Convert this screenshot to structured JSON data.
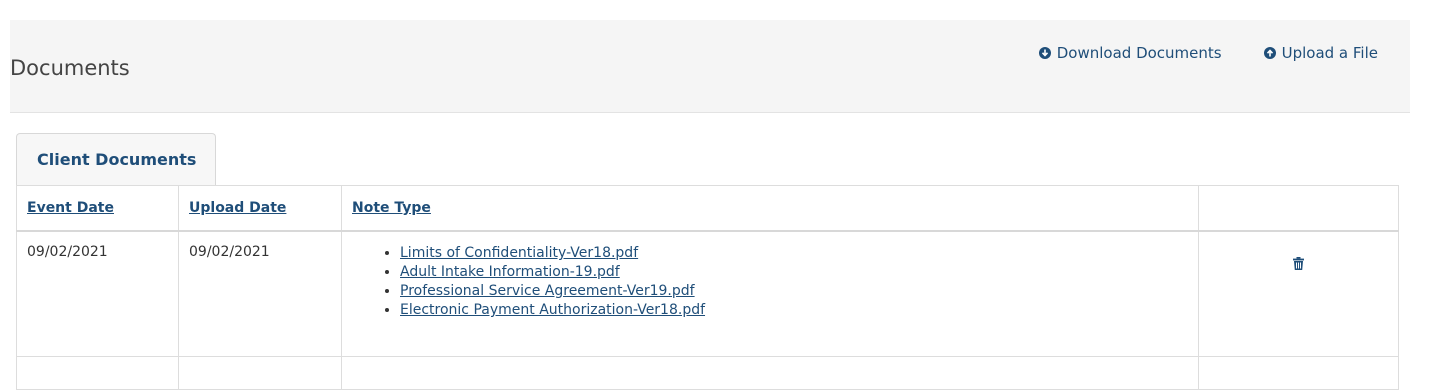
{
  "header": {
    "title": "Documents",
    "download_label": "Download Documents",
    "upload_label": "Upload a File"
  },
  "tab": {
    "label": "Client Documents"
  },
  "table": {
    "columns": [
      "Event Date",
      "Upload Date",
      "Note Type"
    ],
    "rows": [
      {
        "event_date": "09/02/2021",
        "upload_date": "09/02/2021",
        "documents": [
          "Limits of Confidentiality-Ver18.pdf",
          "Adult Intake Information-19.pdf",
          "Professional Service Agreement-Ver19.pdf",
          "Electronic Payment Authorization-Ver18.pdf"
        ]
      }
    ]
  },
  "icons": {
    "download": "circle-arrow-down-icon",
    "upload": "circle-arrow-up-icon",
    "delete": "trash-icon"
  },
  "colors": {
    "link": "#1f4e79",
    "header_bg": "#f5f5f5"
  }
}
